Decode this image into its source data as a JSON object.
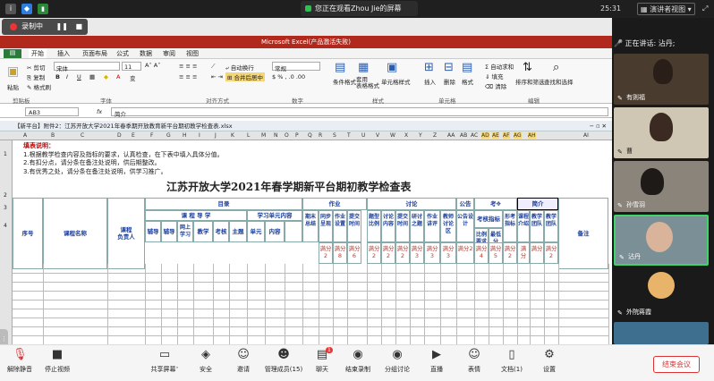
{
  "topbar": {
    "watching": "您正在观看Zhou Jie的屏幕",
    "time": "25:31",
    "view_mode": "演讲者视图",
    "speaker": "正在讲话: 沾丹;"
  },
  "recording": {
    "label": "录制中"
  },
  "excel": {
    "title": "Microsoft Excel(产品激活失败)",
    "tabs": [
      "开始",
      "插入",
      "页面布局",
      "公式",
      "数据",
      "审阅",
      "视图"
    ],
    "ribbon": {
      "cut": "剪切",
      "copy": "复制",
      "format_painter": "格式刷",
      "paste": "粘贴",
      "font": "宋体",
      "size": "11",
      "wrap": "自动换行",
      "merge": "合并后居中",
      "number_format": "常规",
      "cond_format": "条件格式",
      "table_format": "套用\n表格格式",
      "cell_style": "单元格样式",
      "insert": "插入",
      "delete": "删除",
      "format": "格式",
      "autosum": "Σ 自动求和",
      "fill": "填充",
      "clear": "清除",
      "sort": "排序和筛选",
      "find": "查找和选择",
      "groups": [
        "剪贴板",
        "字体",
        "对齐方式",
        "数字",
        "样式",
        "单元格",
        "编辑"
      ]
    },
    "name_box": "AB3",
    "formula": "简介",
    "doc_title": "【新平台】附件2：江苏开放大学2021年春季期开放教育新平台期初教学检查表.xlsx",
    "cols": [
      "A",
      "B",
      "C",
      "D",
      "E",
      "F",
      "G",
      "H",
      "I",
      "J",
      "K",
      "L",
      "M",
      "N",
      "O",
      "P",
      "Q",
      "R",
      "S",
      "T",
      "U",
      "V",
      "W",
      "X",
      "Y",
      "Z",
      "AA",
      "AB",
      "AC",
      "AD",
      "AE",
      "AF",
      "AG",
      "AH",
      "AI"
    ],
    "rows": [
      "1",
      "2",
      "3",
      "4"
    ],
    "notes": {
      "head": "填表说明：",
      "l1": "1.根据教学检查内容及指标的要求，认真检查，在下表中填入具体分值。",
      "l2": "2.有扣分点，请分条在备注处说明，供后期整改。",
      "l3": "3.有优秀之处，请分条在备注处说明，供学习推广。"
    },
    "sheet_title": "江苏开放大学2021年春学期新平台期初教学检查表",
    "headers": {
      "seq": "序号",
      "course": "课程名称",
      "owner": "课程\n负责人",
      "catalog": "目录",
      "zuoye": "作业",
      "taolun": "讨论",
      "gonggao": "公告",
      "kao": "考",
      "jianjie": "简介",
      "beizhu": "备注",
      "guide": "课 程 导 学",
      "unit": "学习单元内容",
      "fu": "辅导",
      "fuer": "辅导",
      "wangshang": "网上\n学习",
      "jiaoxue": "教学",
      "kaohe": "考核",
      "zhuti": "主题",
      "shuoming": "单元",
      "jiaoshi": "内容",
      "zhou": "期末\n总结",
      "kaohezhibiao": "考核指标"
    },
    "subcols": [
      "同步呈现",
      "作业设置",
      "提交时间",
      "题型比例",
      "讨论内容",
      "提交时间",
      "研讨之题",
      "作业讲评",
      "教师讨论区",
      "公告设计",
      "比例要求",
      "最低分",
      "形考指标",
      "课程介绍",
      "教学团队",
      "教学团队"
    ],
    "scores": [
      "满分2",
      "满分8",
      "满分6",
      "满分2",
      "满分2",
      "满分2",
      "满分3",
      "满分3",
      "满分3",
      "满分2",
      "满分4",
      "满分5",
      "满分2",
      "满分",
      "满分",
      "满分2"
    ]
  },
  "participants": [
    {
      "name": "有则福"
    },
    {
      "name": "曹"
    },
    {
      "name": "孙雪羽"
    },
    {
      "name": "沾丹"
    },
    {
      "name": "外院蒋霞"
    },
    {
      "name": ""
    }
  ],
  "bottom": {
    "mute": "解除静音",
    "video": "停止视频",
    "share": "共享屏幕",
    "security": "安全",
    "invite": "邀请",
    "members": "管理成员(15)",
    "chat": "聊天",
    "stoprec": "结束录制",
    "breakout": "分组讨论",
    "live": "直播",
    "reaction": "表情",
    "docs": "文档(1)",
    "settings": "设置",
    "end": "结束会议",
    "chat_badge": "1"
  }
}
